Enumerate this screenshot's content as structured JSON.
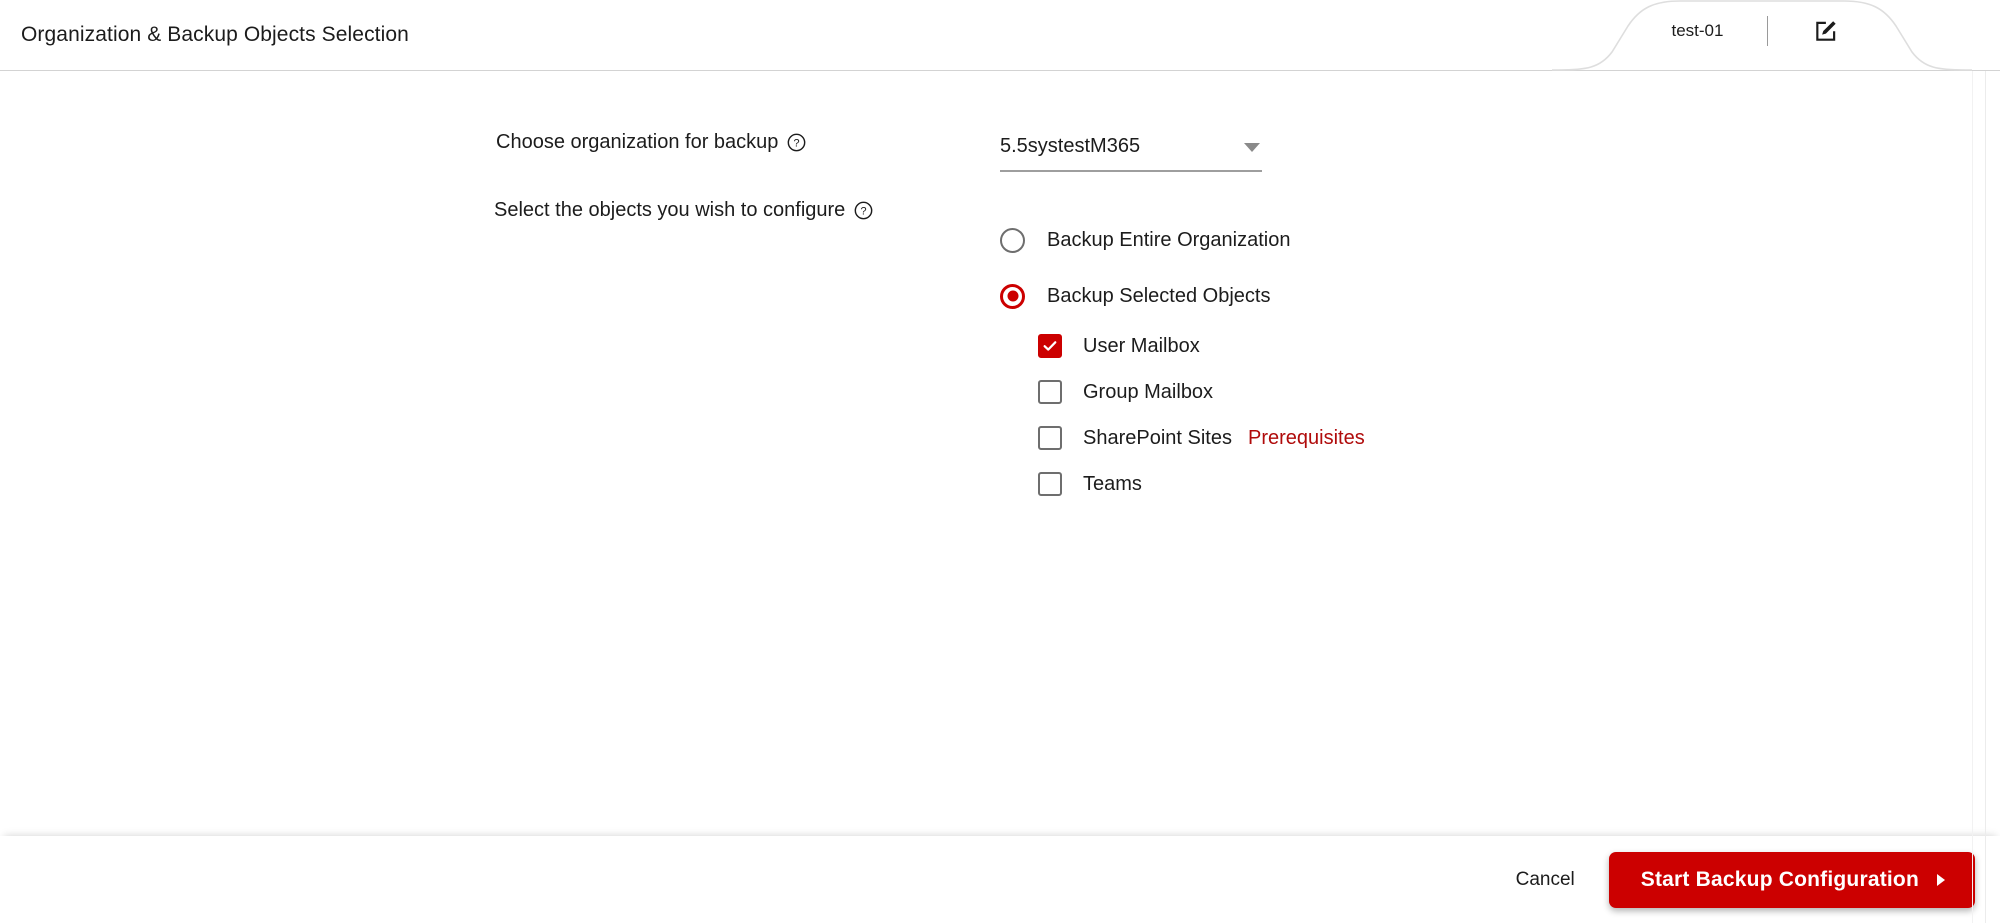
{
  "header": {
    "title": "Organization & Backup Objects Selection",
    "tab": {
      "label": "test-01",
      "edit_icon": "edit-square-pencil-icon"
    }
  },
  "form": {
    "organization": {
      "label": "Choose organization for backup",
      "help_icon": "help-circle-icon",
      "selected_value": "5.5systestM365",
      "caret_icon": "chevron-down-icon"
    },
    "objects": {
      "label": "Select the objects you wish to configure",
      "help_icon": "help-circle-icon",
      "radios": [
        {
          "label": "Backup Entire Organization",
          "checked": false
        },
        {
          "label": "Backup Selected Objects",
          "checked": true
        }
      ],
      "checkboxes": [
        {
          "label": "User Mailbox",
          "checked": true,
          "link": ""
        },
        {
          "label": "Group Mailbox",
          "checked": false,
          "link": ""
        },
        {
          "label": "SharePoint Sites",
          "checked": false,
          "link": "Prerequisites"
        },
        {
          "label": "Teams",
          "checked": false,
          "link": ""
        }
      ]
    }
  },
  "footer": {
    "cancel_label": "Cancel",
    "primary_label": "Start Backup Configuration",
    "primary_arrow_icon": "chevron-right-icon"
  },
  "colors": {
    "accent_red": "#cc0000",
    "link_red": "#b00b0b",
    "text": "#1c1c1c",
    "border_gray": "#d3d3d3",
    "control_gray": "#6e6e6e"
  }
}
